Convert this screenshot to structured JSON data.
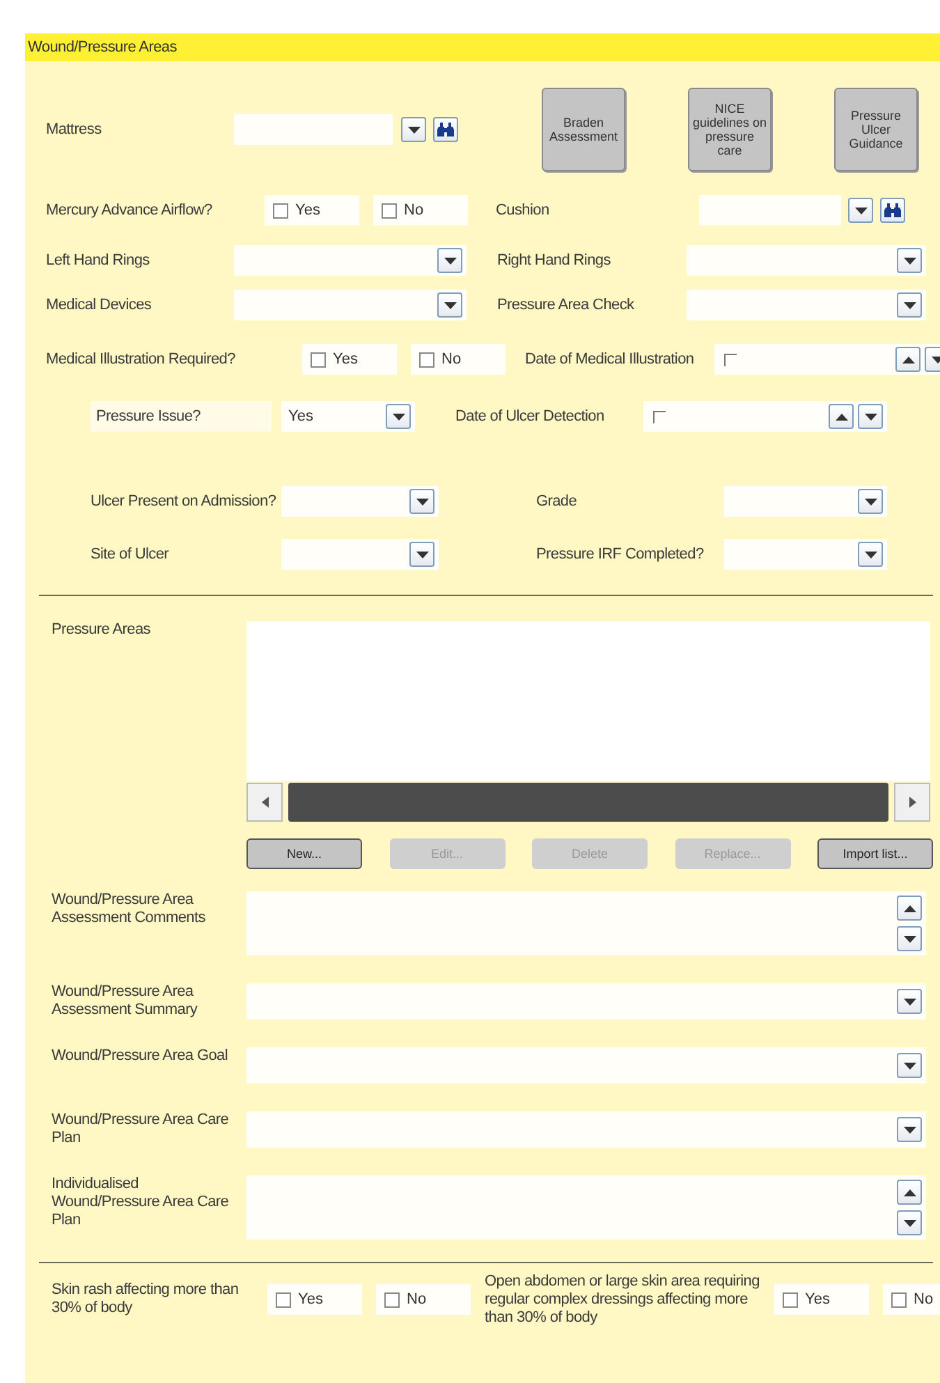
{
  "section_title": "Wound/Pressure Areas",
  "mattress": {
    "label": "Mattress"
  },
  "guidance_buttons": [
    "Braden Assessment",
    "NICE guidelines on pressure care",
    "Pressure Ulcer Guidance"
  ],
  "mercury": {
    "label": "Mercury Advance Airflow?",
    "options": [
      {
        "label": "Yes",
        "checked": false
      },
      {
        "label": "No",
        "checked": false
      }
    ]
  },
  "cushion": {
    "label": "Cushion"
  },
  "left_hand_rings": {
    "label": "Left Hand Rings"
  },
  "right_hand_rings": {
    "label": "Right Hand Rings"
  },
  "medical_devices": {
    "label": "Medical Devices"
  },
  "pressure_area_check": {
    "label": "Pressure Area Check"
  },
  "medical_illustration": {
    "label": "Medical Illustration Required?",
    "options": [
      {
        "label": "Yes",
        "checked": false
      },
      {
        "label": "No",
        "checked": false
      }
    ]
  },
  "date_of_medical_illustration": {
    "label": "Date of Medical Illustration",
    "checked": false
  },
  "pressure_issue": {
    "label": "Pressure Issue?",
    "value": "Yes"
  },
  "date_of_ulcer_detection": {
    "label": "Date of Ulcer Detection",
    "checked": false
  },
  "ulcer_present_on_admission": {
    "label": "Ulcer Present on Admission?"
  },
  "grade": {
    "label": "Grade"
  },
  "site_of_ulcer": {
    "label": "Site of Ulcer"
  },
  "pressure_irf_completed": {
    "label": "Pressure IRF Completed?"
  },
  "pressure_areas": {
    "label": "Pressure Areas",
    "buttons": [
      {
        "label": "New...",
        "disabled": false
      },
      {
        "label": "Edit...",
        "disabled": true
      },
      {
        "label": "Delete",
        "disabled": true
      },
      {
        "label": "Replace...",
        "disabled": true
      },
      {
        "label": "Import list...",
        "disabled": false
      }
    ]
  },
  "text_fields": [
    {
      "label": "Wound/Pressure Area Assessment Comments",
      "kind": "memo"
    },
    {
      "label": "Wound/Pressure Area Assessment Summary",
      "kind": "dropdown"
    },
    {
      "label": "Wound/Pressure Area Goal",
      "kind": "dropdown"
    },
    {
      "label": "Wound/Pressure Area Care Plan",
      "kind": "dropdown"
    },
    {
      "label": "Individualised Wound/Pressure Area Care Plan",
      "kind": "memo"
    }
  ],
  "bottom_questions": [
    {
      "label": "Skin rash affecting more than 30% of body",
      "options": [
        {
          "label": "Yes",
          "checked": false
        },
        {
          "label": "No",
          "checked": false
        }
      ]
    },
    {
      "label": "Open abdomen or large skin area requiring regular complex dressings affecting more than 30% of body",
      "options": [
        {
          "label": "Yes",
          "checked": false
        },
        {
          "label": "No",
          "checked": false
        }
      ]
    }
  ]
}
